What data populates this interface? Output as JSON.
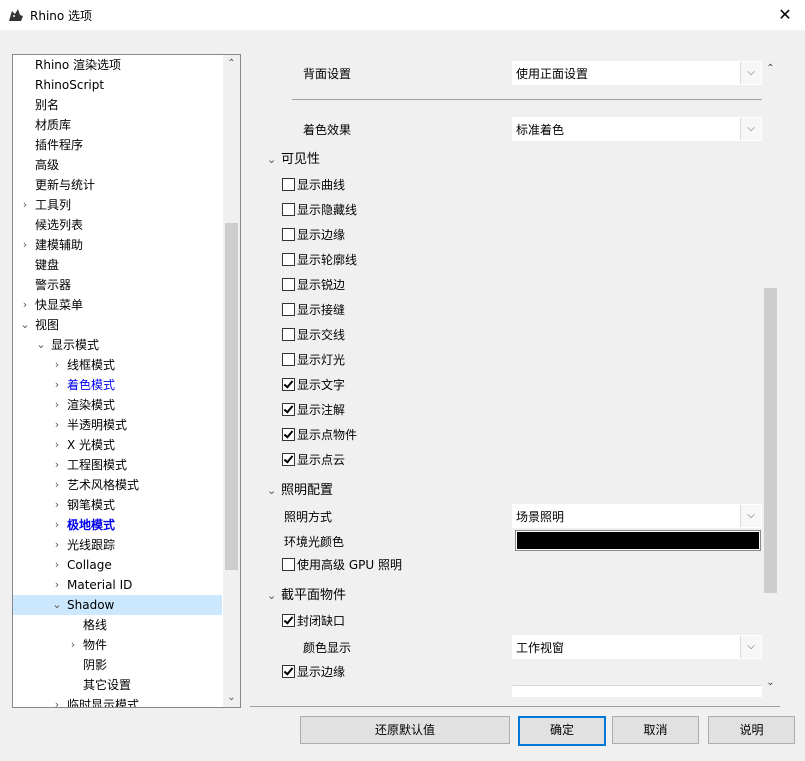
{
  "window": {
    "title": "Rhino 选项",
    "close_symbol": "✕"
  },
  "tree": {
    "items": [
      {
        "label": "Rhino 渲染选项",
        "chev": ""
      },
      {
        "label": "RhinoScript",
        "chev": ""
      },
      {
        "label": "别名",
        "chev": ""
      },
      {
        "label": "材质库",
        "chev": ""
      },
      {
        "label": "插件程序",
        "chev": ""
      },
      {
        "label": "高级",
        "chev": ""
      },
      {
        "label": "更新与统计",
        "chev": ""
      },
      {
        "label": "工具列",
        "chev": "›"
      },
      {
        "label": "候选列表",
        "chev": ""
      },
      {
        "label": "建模辅助",
        "chev": "›"
      },
      {
        "label": "键盘",
        "chev": ""
      },
      {
        "label": "警示器",
        "chev": ""
      },
      {
        "label": "快显菜单",
        "chev": "›"
      },
      {
        "label": "视图",
        "chev": "⌄"
      },
      {
        "label": "显示模式",
        "chev": "⌄"
      },
      {
        "label": "线框模式",
        "chev": "›"
      },
      {
        "label": "着色模式",
        "chev": "›"
      },
      {
        "label": "渲染模式",
        "chev": "›"
      },
      {
        "label": "半透明模式",
        "chev": "›"
      },
      {
        "label": "X 光模式",
        "chev": "›"
      },
      {
        "label": "工程图模式",
        "chev": "›"
      },
      {
        "label": "艺术风格模式",
        "chev": "›"
      },
      {
        "label": "钢笔模式",
        "chev": "›"
      },
      {
        "label": "极地模式",
        "chev": "›"
      },
      {
        "label": "光线跟踪",
        "chev": "›"
      },
      {
        "label": "Collage",
        "chev": "›"
      },
      {
        "label": "Material ID",
        "chev": "›"
      },
      {
        "label": "Shadow",
        "chev": "⌄"
      },
      {
        "label": "格线",
        "chev": ""
      },
      {
        "label": "物件",
        "chev": "›"
      },
      {
        "label": "阴影",
        "chev": ""
      },
      {
        "label": "其它设置",
        "chev": ""
      },
      {
        "label": "临时显示模式",
        "chev": "›"
      }
    ]
  },
  "panel": {
    "back_face_label": "背面设置",
    "back_face_value": "使用正面设置",
    "shading_label": "着色效果",
    "shading_value": "标准着色",
    "visibility_header": "可见性",
    "visibility_checks": [
      {
        "label": "显示曲线",
        "checked": false
      },
      {
        "label": "显示隐藏线",
        "checked": false
      },
      {
        "label": "显示边缘",
        "checked": false
      },
      {
        "label": "显示轮廓线",
        "checked": false
      },
      {
        "label": "显示锐边",
        "checked": false
      },
      {
        "label": "显示接缝",
        "checked": false
      },
      {
        "label": "显示交线",
        "checked": false
      },
      {
        "label": "显示灯光",
        "checked": false
      },
      {
        "label": "显示文字",
        "checked": true
      },
      {
        "label": "显示注解",
        "checked": true
      },
      {
        "label": "显示点物件",
        "checked": true
      },
      {
        "label": "显示点云",
        "checked": true
      }
    ],
    "lighting_header": "照明配置",
    "lighting_method_label": "照明方式",
    "lighting_method_value": "场景照明",
    "ambient_label": "环境光颜色",
    "ambient_color": "#000000",
    "gpu_lighting_label": "使用高级 GPU 照明",
    "gpu_lighting_checked": false,
    "clipping_header": "截平面物件",
    "capping_label": "封闭缺口",
    "capping_checked": true,
    "color_display_label": "颜色显示",
    "color_display_value": "工作视窗",
    "show_edges_label": "显示边缘",
    "show_edges_checked": true
  },
  "buttons": {
    "restore_defaults": "还原默认值",
    "ok": "确定",
    "cancel": "取消",
    "help": "说明"
  },
  "colors": {
    "selection": "#cce8ff",
    "link_blue": "#0000ee",
    "default_button_border": "#0078d7"
  }
}
